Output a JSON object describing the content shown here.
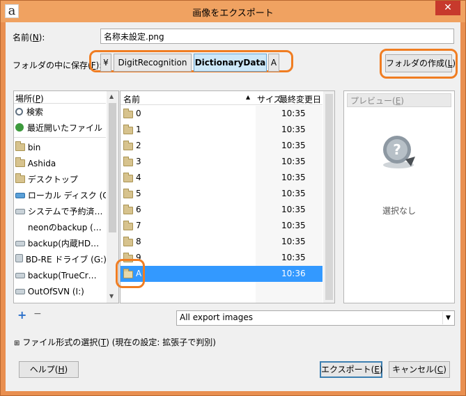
{
  "window": {
    "title": "画像をエクスポート",
    "logo": "a",
    "close_glyph": "✕"
  },
  "name_row": {
    "label": "名前(",
    "label_key": "N",
    "label_end": "):",
    "value": "名称未設定.png"
  },
  "save_in": {
    "label": "フォルダの中に保存(",
    "label_key": "F",
    "label_end": "):",
    "crumbs": [
      {
        "label": "¥"
      },
      {
        "label": "DigitRecognition"
      },
      {
        "label": "DictionaryData",
        "active": true
      },
      {
        "label": "A"
      }
    ],
    "create_folder": {
      "label": "フォルダの作成(",
      "key": "L",
      "end": ")"
    }
  },
  "places": {
    "header": "場所(",
    "header_key": "P",
    "header_end": ")",
    "items": [
      {
        "label": "検索",
        "icon": "search-icon"
      },
      {
        "label": "最近開いたファイル",
        "icon": "recent-icon"
      },
      {
        "label": "bin",
        "icon": "folder-icon"
      },
      {
        "label": "Ashida",
        "icon": "folder-icon"
      },
      {
        "label": "デスクトップ",
        "icon": "folder-icon"
      },
      {
        "label": "ローカル ディスク (C:)",
        "icon": "drive-icon"
      },
      {
        "label": "システムで予約済…",
        "icon": "drive-icon"
      },
      {
        "label": "neonのbackup (…",
        "icon": ""
      },
      {
        "label": "backup(内蔵HD…",
        "icon": "drive-icon"
      },
      {
        "label": "BD-RE ドライブ (G:)",
        "icon": "optical-drive-icon"
      },
      {
        "label": "backup(TrueCr…",
        "icon": "drive-icon"
      },
      {
        "label": "OutOfSVN (I:)",
        "icon": "drive-icon"
      }
    ],
    "add_glyph": "+",
    "remove_glyph": "−"
  },
  "files": {
    "col_name": "名前",
    "col_size": "サイズ",
    "col_date": "最終変更日",
    "sort_glyph": "▲",
    "rows": [
      {
        "name": "0",
        "time": "10:35"
      },
      {
        "name": "1",
        "time": "10:35"
      },
      {
        "name": "2",
        "time": "10:35"
      },
      {
        "name": "3",
        "time": "10:35"
      },
      {
        "name": "4",
        "time": "10:35"
      },
      {
        "name": "5",
        "time": "10:35"
      },
      {
        "name": "6",
        "time": "10:35"
      },
      {
        "name": "7",
        "time": "10:35"
      },
      {
        "name": "8",
        "time": "10:35"
      },
      {
        "name": "9",
        "time": "10:35"
      },
      {
        "name": "A",
        "time": "10:36",
        "selected": true
      }
    ]
  },
  "preview": {
    "header": "プレビュー(",
    "header_key": "E",
    "header_end": ")",
    "none_text": "選択なし"
  },
  "file_type_filter": {
    "value": "All export images"
  },
  "file_type_toggle": {
    "glyph": "⊞",
    "label": "ファイル形式の選択(",
    "key": "T",
    "end": ") (現在の設定: 拡張子で判別)"
  },
  "buttons": {
    "help": {
      "label": "ヘルプ(",
      "key": "H",
      "end": ")"
    },
    "export": {
      "label": "エクスポート(",
      "key": "E",
      "end": ")"
    },
    "cancel": {
      "label": "キャンセル(",
      "key": "C",
      "end": ")"
    }
  },
  "colors": {
    "annotation": "#f07d22",
    "selection": "#3399ff",
    "title_bar": "#f0a261",
    "close": "#c7392c"
  }
}
